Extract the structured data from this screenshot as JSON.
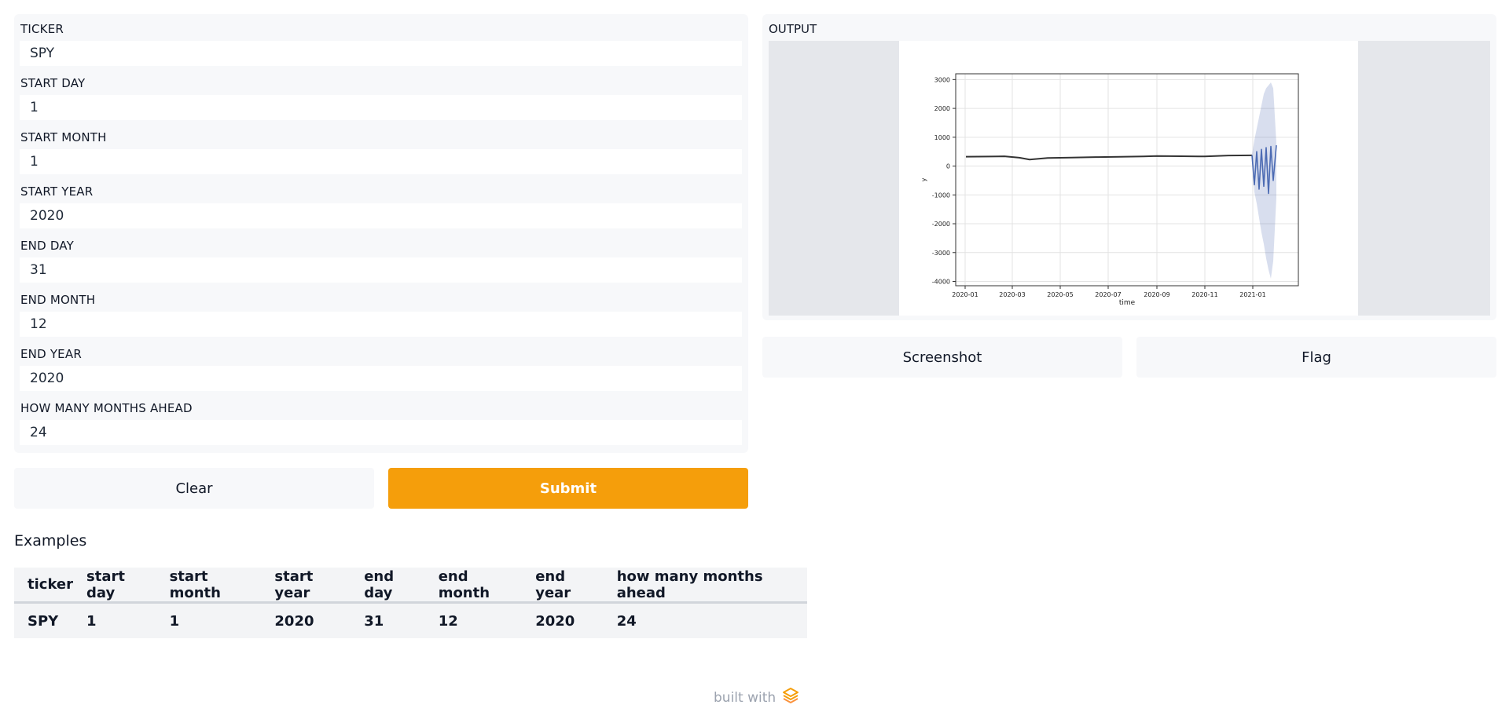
{
  "inputs": [
    {
      "label": "TICKER",
      "value": "SPY"
    },
    {
      "label": "START DAY",
      "value": "1"
    },
    {
      "label": "START MONTH",
      "value": "1"
    },
    {
      "label": "START YEAR",
      "value": "2020"
    },
    {
      "label": "END DAY",
      "value": "31"
    },
    {
      "label": "END MONTH",
      "value": "12"
    },
    {
      "label": "END YEAR",
      "value": "2020"
    },
    {
      "label": "HOW MANY MONTHS AHEAD",
      "value": "24"
    }
  ],
  "buttons": {
    "clear": "Clear",
    "submit": "Submit",
    "screenshot": "Screenshot",
    "flag": "Flag"
  },
  "output": {
    "label": "OUTPUT"
  },
  "colors": {
    "accent": "#f59e0b",
    "forecast": "#4c6bb3",
    "history": "#333333"
  },
  "chart_data": {
    "type": "line",
    "title": "",
    "xlabel": "time",
    "ylabel": "y",
    "x_ticks": [
      "2020-01",
      "2020-03",
      "2020-05",
      "2020-07",
      "2020-09",
      "2020-11",
      "2021-01"
    ],
    "y_ticks": [
      3000,
      2000,
      1000,
      0,
      -1000,
      -2000,
      -3000,
      -4000
    ],
    "xlim": [
      "2019-12-20",
      "2021-02-28"
    ],
    "ylim": [
      -4150,
      3200
    ],
    "grid": true,
    "series": [
      {
        "role": "history",
        "x": [
          "2020-01-02",
          "2020-02-01",
          "2020-02-20",
          "2020-03-10",
          "2020-03-23",
          "2020-04-15",
          "2020-05-15",
          "2020-06-15",
          "2020-07-15",
          "2020-08-15",
          "2020-09-01",
          "2020-10-01",
          "2020-11-01",
          "2020-12-01",
          "2020-12-31"
        ],
        "y": [
          323,
          330,
          338,
          290,
          225,
          280,
          295,
          310,
          320,
          335,
          350,
          340,
          335,
          365,
          373
        ]
      },
      {
        "role": "forecast",
        "x": [
          "2020-12-31",
          "2021-01-03",
          "2021-01-06",
          "2021-01-09",
          "2021-01-12",
          "2021-01-15",
          "2021-01-18",
          "2021-01-21",
          "2021-01-24",
          "2021-01-27",
          "2021-01-31"
        ],
        "y": [
          380,
          -650,
          500,
          -800,
          580,
          -700,
          640,
          -950,
          680,
          -500,
          720
        ],
        "upper": [
          400,
          900,
          1300,
          1700,
          2100,
          2500,
          2700,
          2800,
          2900,
          2700,
          800
        ],
        "lower": [
          350,
          -900,
          -1300,
          -1800,
          -2300,
          -2700,
          -3200,
          -3600,
          -3900,
          -3300,
          -1100
        ]
      }
    ]
  },
  "examples": {
    "title": "Examples",
    "headers": [
      "ticker",
      "start day",
      "start month",
      "start year",
      "end day",
      "end month",
      "end year",
      "how many months ahead"
    ],
    "rows": [
      [
        "SPY",
        "1",
        "1",
        "2020",
        "31",
        "12",
        "2020",
        "24"
      ]
    ]
  },
  "footer": {
    "text": "built with"
  }
}
